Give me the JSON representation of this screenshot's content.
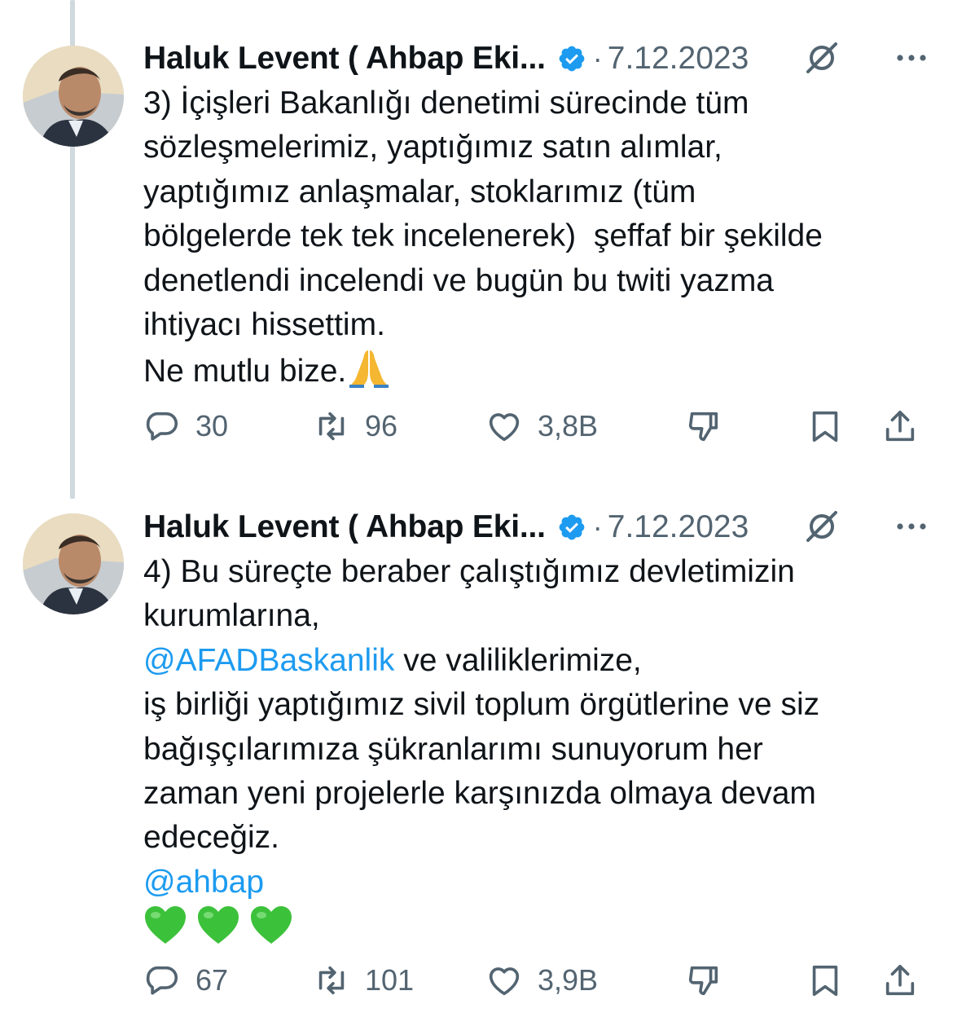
{
  "tweets": [
    {
      "author": "Haluk Levent ( Ahbap Eki...",
      "date": "7.12.2023",
      "separator": "·",
      "text_lines": [
        "3) İçişleri Bakanlığı denetimi sürecinde tüm",
        "sözleşmelerimiz, yaptığımız satın alımlar,",
        "yaptığımız anlaşmalar, stoklarımız (tüm",
        "bölgelerde tek tek incelenerek)  şeffaf bir şekilde",
        "denetlendi incelendi ve bugün bu twiti yazma",
        "ihtiyacı hissettim.",
        "Ne mutlu bize."
      ],
      "end_emoji": "pray-emoji",
      "replies": "30",
      "retweets": "96",
      "likes": "3,8B"
    },
    {
      "author": "Haluk Levent ( Ahbap Eki...",
      "date": "7.12.2023",
      "separator": "·",
      "line1": "4) Bu süreçte beraber çalıştığımız devletimizin",
      "line2": "kurumlarına,",
      "mention1": "@AFADBaskanlik",
      "line3_rest": " ve valiliklerimize,",
      "line4": "iş birliği yaptığımız sivil toplum örgütlerine ve siz",
      "line5": "bağışçılarımıza şükranlarımı sunuyorum her",
      "line6": "zaman yeni projelerle karşınızda olmaya devam",
      "line7": "edeceğiz.",
      "mention2": "@ahbap",
      "end_emojis": [
        "green-heart-emoji",
        "green-heart-emoji",
        "green-heart-emoji"
      ],
      "replies": "67",
      "retweets": "101",
      "likes": "3,9B"
    }
  ],
  "colors": {
    "text": "#0f1419",
    "secondary": "#536471",
    "link": "#1d9bf0",
    "verified": "#1d9bf0",
    "thread_line": "#cfd9de"
  },
  "icons": [
    "verified-badge-icon",
    "grok-icon",
    "more-icon",
    "reply-icon",
    "retweet-icon",
    "like-icon",
    "dislike-icon",
    "bookmark-icon",
    "share-icon"
  ]
}
